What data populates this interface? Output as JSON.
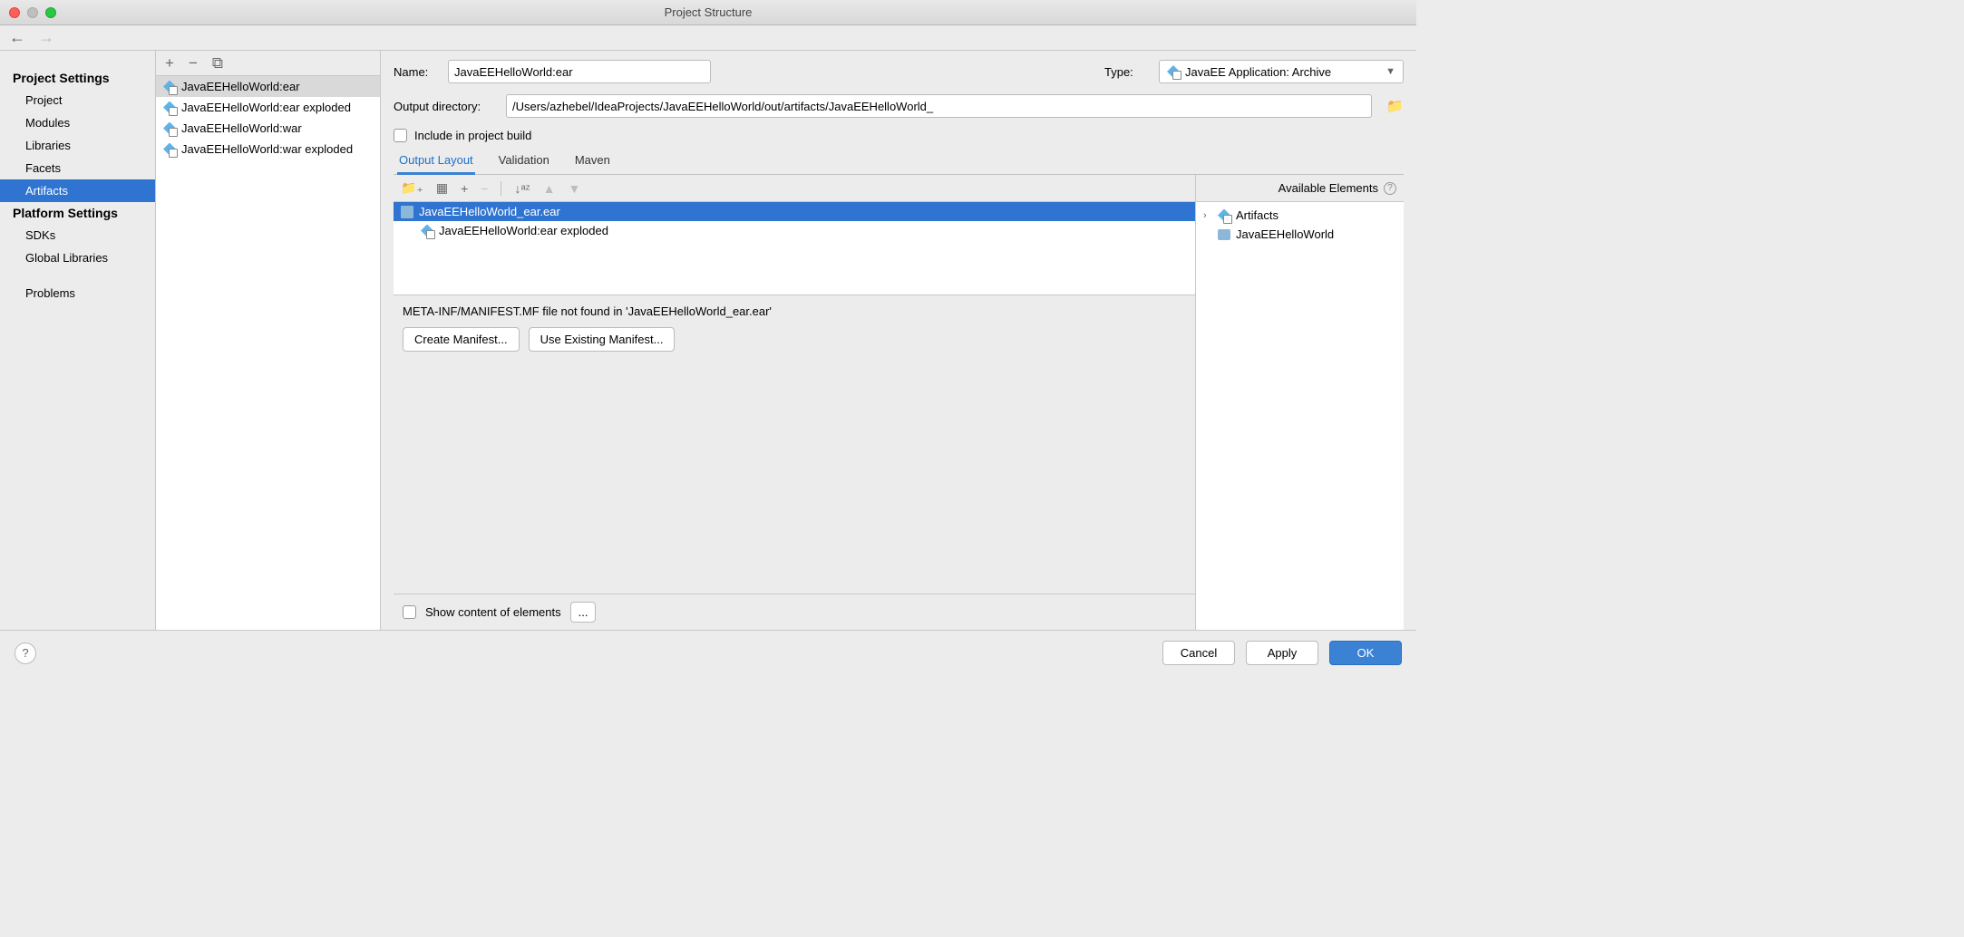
{
  "window": {
    "title": "Project Structure"
  },
  "sidebar": {
    "groups": [
      {
        "heading": "Project Settings",
        "items": [
          "Project",
          "Modules",
          "Libraries",
          "Facets",
          "Artifacts"
        ]
      },
      {
        "heading": "Platform Settings",
        "items": [
          "SDKs",
          "Global Libraries"
        ]
      },
      {
        "heading": "",
        "items": [
          "Problems"
        ]
      }
    ],
    "selected": "Artifacts"
  },
  "artifacts": {
    "items": [
      "JavaEEHelloWorld:ear",
      "JavaEEHelloWorld:ear exploded",
      "JavaEEHelloWorld:war",
      "JavaEEHelloWorld:war exploded"
    ],
    "selected": 0
  },
  "detail": {
    "name_label": "Name:",
    "name_value": "JavaEEHelloWorld:ear",
    "type_label": "Type:",
    "type_value": "JavaEE Application: Archive",
    "outdir_label": "Output directory:",
    "outdir_value": "/Users/azhebel/IdeaProjects/JavaEEHelloWorld/out/artifacts/JavaEEHelloWorld_",
    "include_label": "Include in project build",
    "tabs": [
      "Output Layout",
      "Validation",
      "Maven"
    ],
    "active_tab": 0,
    "tree": {
      "root": "JavaEEHelloWorld_ear.ear",
      "child": "JavaEEHelloWorld:ear exploded"
    },
    "manifest_msg": "META-INF/MANIFEST.MF file not found in 'JavaEEHelloWorld_ear.ear'",
    "create_manifest": "Create Manifest...",
    "use_existing": "Use Existing Manifest...",
    "show_content": "Show content of elements",
    "ellipsis": "..."
  },
  "available": {
    "header": "Available Elements",
    "rows": [
      "Artifacts",
      "JavaEEHelloWorld"
    ]
  },
  "footer": {
    "cancel": "Cancel",
    "apply": "Apply",
    "ok": "OK"
  }
}
